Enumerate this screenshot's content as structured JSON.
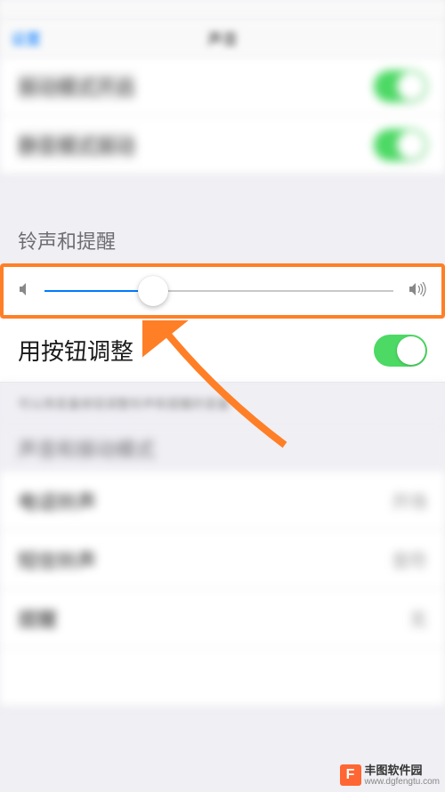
{
  "nav": {
    "back": "设置",
    "title": "声音"
  },
  "section1": {
    "row1_label": "振动模式开启",
    "row2_label": "静音模式振动"
  },
  "ringer_section": {
    "header": "铃声和提醒",
    "slider_value": 31,
    "button_adjust_label": "用按钮调整",
    "footer_text": "可以用音量按钮调整铃声和提醒的音量"
  },
  "sounds_section": {
    "header": "声音和振动模式",
    "rows": [
      {
        "label": "电话铃声",
        "value": "开场"
      },
      {
        "label": "短信铃声",
        "value": "音符"
      },
      {
        "label": "提醒",
        "value": "无"
      }
    ]
  },
  "watermark": {
    "name": "丰图软件园",
    "url": "www.dgfengtu.com"
  }
}
